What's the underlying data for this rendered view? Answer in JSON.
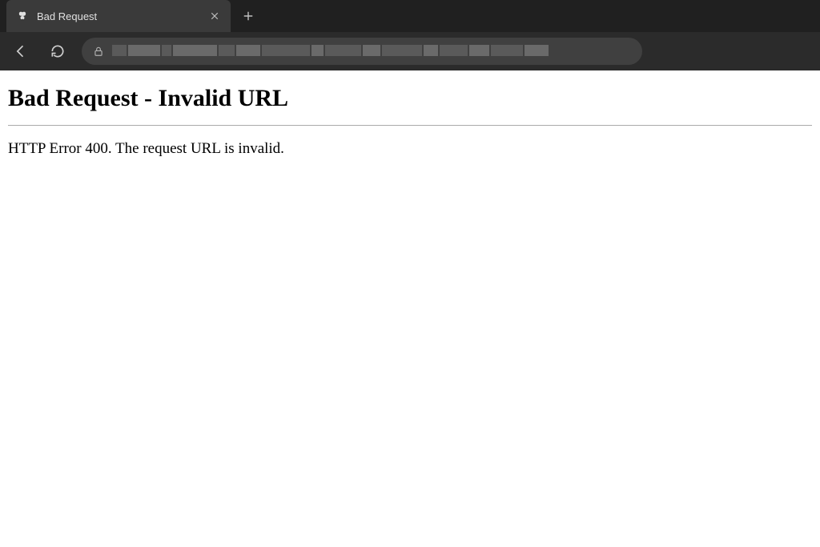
{
  "tab": {
    "title": "Bad Request"
  },
  "error": {
    "heading": "Bad Request - Invalid URL",
    "message": "HTTP Error 400. The request URL is invalid."
  }
}
